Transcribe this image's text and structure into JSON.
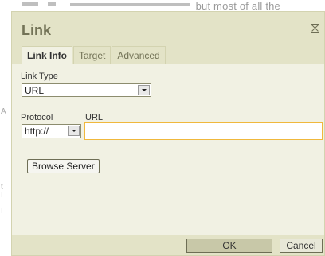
{
  "background": {
    "text": "but most of all the"
  },
  "dialog": {
    "title": "Link",
    "tabs": [
      {
        "label": "Link Info",
        "active": true
      },
      {
        "label": "Target",
        "active": false
      },
      {
        "label": "Advanced",
        "active": false
      }
    ],
    "link_type": {
      "label": "Link Type",
      "value": "URL"
    },
    "protocol": {
      "label": "Protocol",
      "value": "http://"
    },
    "url": {
      "label": "URL",
      "value": ""
    },
    "browse_label": "Browse Server",
    "ok_label": "OK",
    "cancel_label": "Cancel"
  },
  "colors": {
    "dialog_bg": "#e3e3c7",
    "panel_bg": "#f1f1e3",
    "title": "#737357",
    "focus_border": "#f0b83c"
  }
}
